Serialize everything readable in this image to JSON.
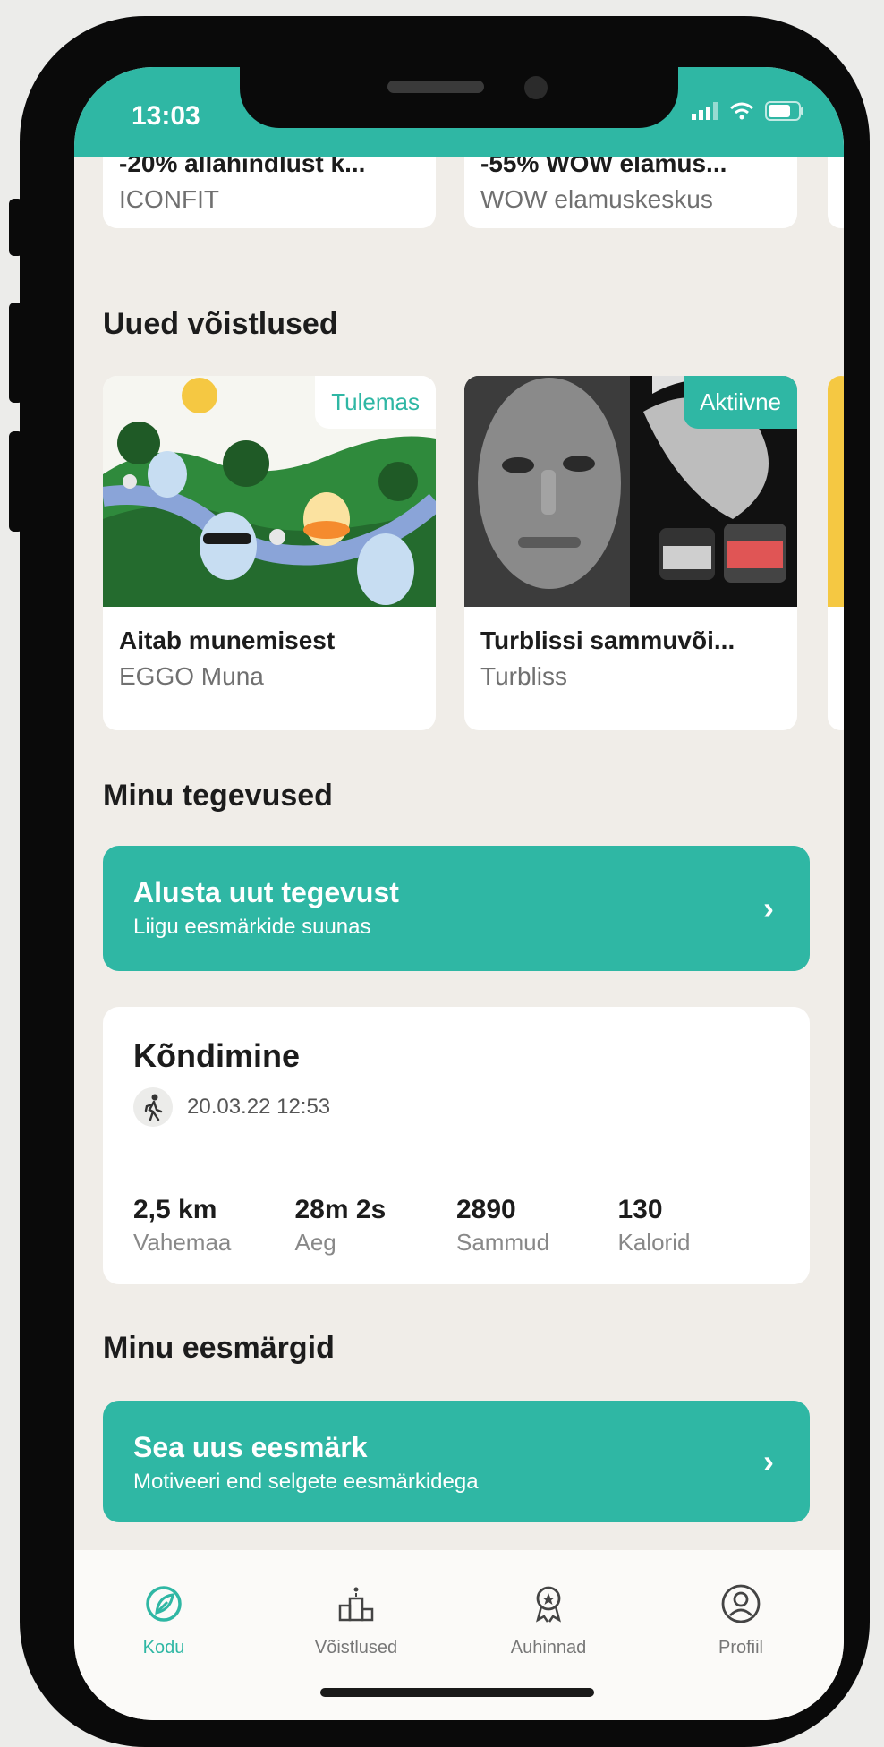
{
  "status_bar": {
    "time": "13:03"
  },
  "offers": [
    {
      "title": "-20% allahindlust k...",
      "brand": "ICONFIT"
    },
    {
      "title": "-55% WOW elamus...",
      "brand": "WOW elamuskeskus"
    }
  ],
  "sections": {
    "competitions": "Uued võistlused",
    "activities": "Minu tegevused",
    "goals": "Minu eesmärgid"
  },
  "competitions": [
    {
      "badge": "Tulemas",
      "title": "Aitab munemisest",
      "brand": "EGGO Muna"
    },
    {
      "badge": "Aktiivne",
      "title": "Turblissi sammuvõi...",
      "brand": "Turbliss"
    }
  ],
  "start_activity": {
    "title": "Alusta uut tegevust",
    "subtitle": "Liigu eesmärkide suunas"
  },
  "activity": {
    "title": "Kõndimine",
    "icon": "walking-icon",
    "date": "20.03.22 12:53",
    "stats": [
      {
        "value": "2,5 km",
        "label": "Vahemaa"
      },
      {
        "value": "28m 2s",
        "label": "Aeg"
      },
      {
        "value": "2890",
        "label": "Sammud"
      },
      {
        "value": "130",
        "label": "Kalorid"
      }
    ]
  },
  "new_goal": {
    "title": "Sea uus eesmärk",
    "subtitle": "Motiveeri end selgete eesmärkidega"
  },
  "bottom_nav": [
    {
      "label": "Kodu",
      "icon": "home-leaf-icon",
      "active": true
    },
    {
      "label": "Võistlused",
      "icon": "podium-icon",
      "active": false
    },
    {
      "label": "Auhinnad",
      "icon": "award-icon",
      "active": false
    },
    {
      "label": "Profiil",
      "icon": "profile-icon",
      "active": false
    }
  ],
  "colors": {
    "accent": "#2fb7a4",
    "background": "#f0ede8",
    "card": "#ffffff"
  }
}
